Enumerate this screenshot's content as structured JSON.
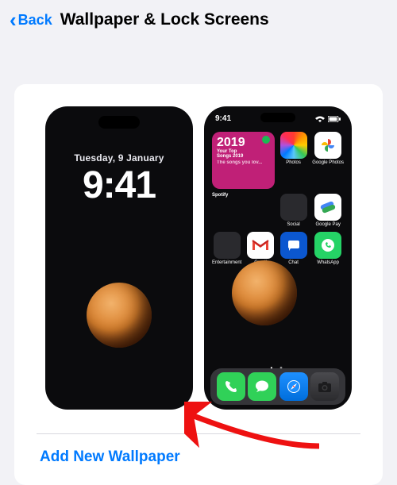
{
  "header": {
    "back_label": "Back",
    "title": "Wallpaper & Lock Screens"
  },
  "lock_screen": {
    "date": "Tuesday, 9 January",
    "time": "9:41"
  },
  "home_screen": {
    "status_time": "9:41",
    "widget": {
      "year": "2019",
      "line1": "Your Top",
      "line2": "Songs 2019",
      "sub": "The songs you lov...",
      "app_label": "Spotify"
    },
    "apps": {
      "photos": "Photos",
      "gphotos": "Google Photos",
      "social": "Social",
      "gpay": "Google Pay",
      "entertainment": "Entertainment",
      "gmail": "Gmail",
      "chat": "Chat",
      "whatsapp": "WhatsApp"
    }
  },
  "actions": {
    "add_new": "Add New Wallpaper"
  },
  "colors": {
    "accent": "#007aff",
    "widget_bg": "#c02077"
  }
}
